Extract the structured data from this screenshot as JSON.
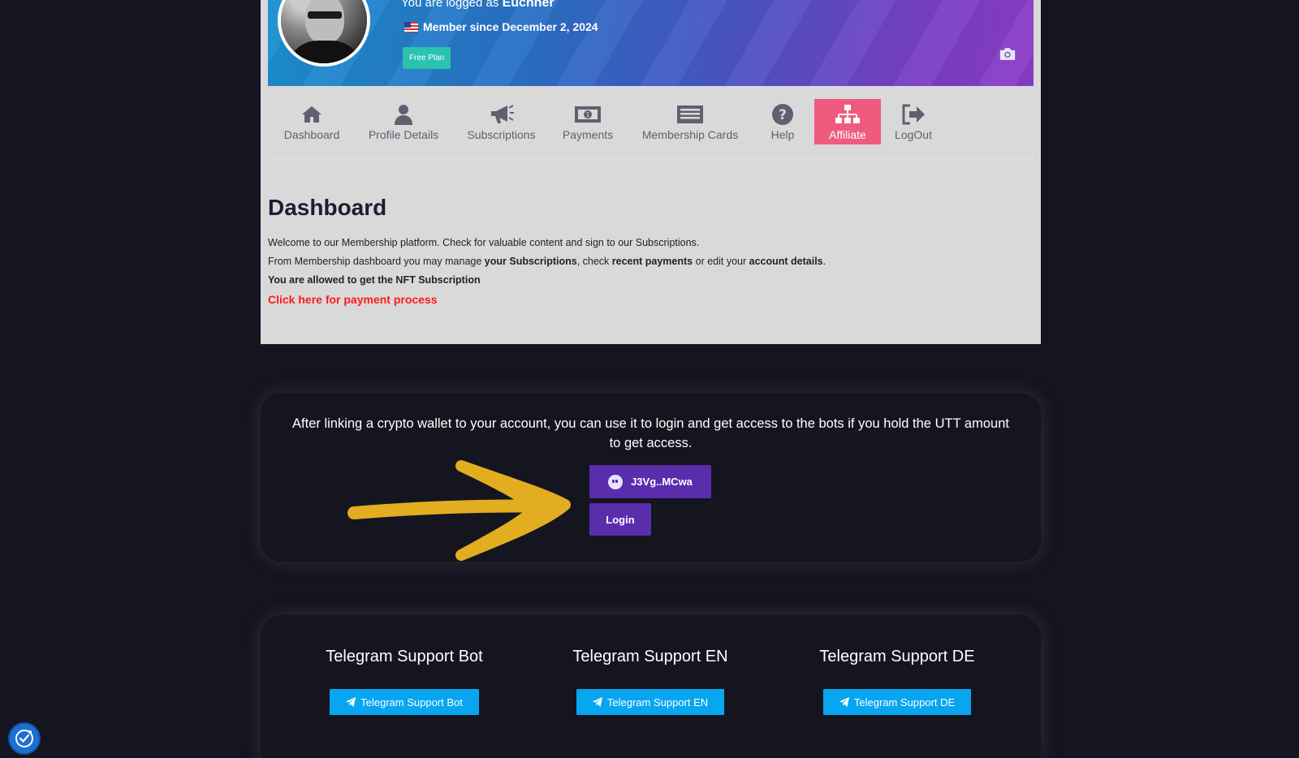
{
  "profile": {
    "logged_prefix": "You are logged as ",
    "username": "Euchner",
    "member_since": "Member since December 2, 2024",
    "plan": "Free Plan"
  },
  "nav": {
    "items": [
      {
        "label": "Dashboard",
        "icon": "home-icon"
      },
      {
        "label": "Profile Details",
        "icon": "user-icon"
      },
      {
        "label": "Subscriptions",
        "icon": "megaphone-icon"
      },
      {
        "label": "Payments",
        "icon": "money-icon"
      },
      {
        "label": "Membership Cards",
        "icon": "card-list-icon"
      },
      {
        "label": "Help",
        "icon": "question-icon"
      },
      {
        "label": "Affiliate",
        "icon": "sitemap-icon"
      },
      {
        "label": "LogOut",
        "icon": "logout-icon"
      }
    ],
    "active": "Affiliate",
    "active_color": "#ee5b7d"
  },
  "dashboard": {
    "title": "Dashboard",
    "welcome": "Welcome to our Membership platform. Check for valuable content and sign to our Subscriptions.",
    "manage_prefix": "From Membership dashboard you may manage ",
    "manage_subscriptions": "your Subscriptions",
    "manage_mid1": ", check ",
    "manage_payments": "recent payments",
    "manage_mid2": " or edit your ",
    "manage_account": "account details",
    "manage_suffix": ".",
    "nft_notice": "You are allowed to get the NFT Subscription",
    "payment_link": "Click here for payment process"
  },
  "wallet": {
    "description": "After linking a crypto wallet to your account, you can use it to login and get access to the bots if you hold the UTT amount to get access.",
    "address_button": "J3Vg..MCwa",
    "login_button": "Login"
  },
  "support": {
    "columns": [
      {
        "title": "Telegram Support Bot",
        "button": "Telegram Support Bot"
      },
      {
        "title": "Telegram Support EN",
        "button": "Telegram Support EN"
      },
      {
        "title": "Telegram Support DE",
        "button": "Telegram Support DE"
      }
    ]
  },
  "colors": {
    "page_bg": "#141521",
    "panel_bg": "#d9d9d9",
    "accent_purple": "#5a2dad",
    "telegram_blue": "#08a6f0",
    "arrow": "#e2ad20",
    "link_red": "#ff1a1a"
  }
}
